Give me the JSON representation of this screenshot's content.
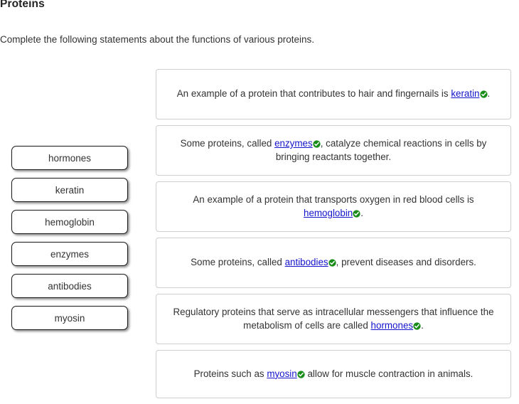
{
  "page": {
    "title": "Proteins",
    "instructions": "Complete the following statements about the functions of various proteins."
  },
  "word_bank": {
    "items": [
      {
        "label": "hormones"
      },
      {
        "label": "keratin"
      },
      {
        "label": "hemoglobin"
      },
      {
        "label": "enzymes"
      },
      {
        "label": "antibodies"
      },
      {
        "label": "myosin"
      }
    ]
  },
  "statements": [
    {
      "before": "An example of a protein that contributes to hair and fingernails is ",
      "answer": "keratin",
      "after": ".",
      "status_icon": "check-circle-icon",
      "status": "correct"
    },
    {
      "before": "Some proteins, called ",
      "answer": "enzymes",
      "after": ", catalyze chemical reactions in cells by bringing reactants together.",
      "status_icon": "check-circle-icon",
      "status": "correct"
    },
    {
      "before": "An example of a protein that transports oxygen in red blood cells is ",
      "answer": "hemoglobin",
      "after": ".",
      "status_icon": "check-circle-icon",
      "status": "correct"
    },
    {
      "before": "Some proteins, called ",
      "answer": "antibodies",
      "after": ", prevent diseases and disorders.",
      "status_icon": "check-circle-icon",
      "status": "correct"
    },
    {
      "before": "Regulatory proteins that serve as intracellular messengers that influence the metabolism of cells are called ",
      "answer": "hormones",
      "after": ".",
      "status_icon": "check-circle-icon",
      "status": "correct"
    },
    {
      "before": "Proteins such as ",
      "answer": "myosin",
      "after": " allow for muscle contraction in animals.",
      "status_icon": "check-circle-icon",
      "status": "correct"
    }
  ],
  "colors": {
    "link": "#1414cc",
    "correct": "#1a8c1a",
    "text": "#333333",
    "box_border": "#cfcfcf",
    "token_border": "#1a1a1a"
  }
}
